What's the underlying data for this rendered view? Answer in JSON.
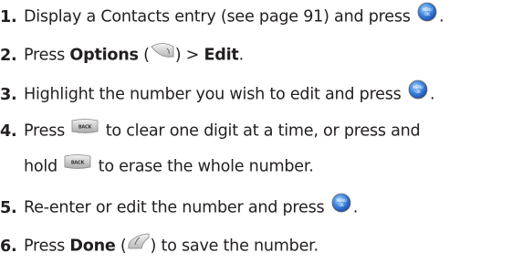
{
  "steps": [
    {
      "number": "1.",
      "pre": "Display a Contacts entry (see page 91) and press",
      "post": "."
    },
    {
      "number": "2.",
      "pre": "Press ",
      "bold1": "Options",
      "mid": " (",
      "post1": ") > ",
      "bold2": "Edit",
      "post": "."
    },
    {
      "number": "3.",
      "pre": "Highlight the number you wish to edit and press",
      "post": "."
    },
    {
      "number": "4.",
      "pre": "Press",
      "post": "to clear one digit at a time, or press and"
    },
    {
      "number": "",
      "pre": "hold",
      "post": "to erase the whole number."
    },
    {
      "number": "5.",
      "pre": "Re-enter or edit the number and press",
      "post": "."
    },
    {
      "number": "6.",
      "pre": "Press ",
      "bold1": "Done",
      "mid": " (",
      "post": ") to save the number."
    }
  ],
  "icons": {
    "menu_ok_key": {
      "name": "menu-ok-key-icon",
      "line1": "MENU",
      "line2": "OK",
      "color": "#3b7fd9"
    },
    "back_key": {
      "name": "back-key-icon",
      "label": "BACK"
    },
    "right_softkey": {
      "name": "right-softkey-icon"
    },
    "left_softkey": {
      "name": "left-softkey-icon"
    }
  }
}
